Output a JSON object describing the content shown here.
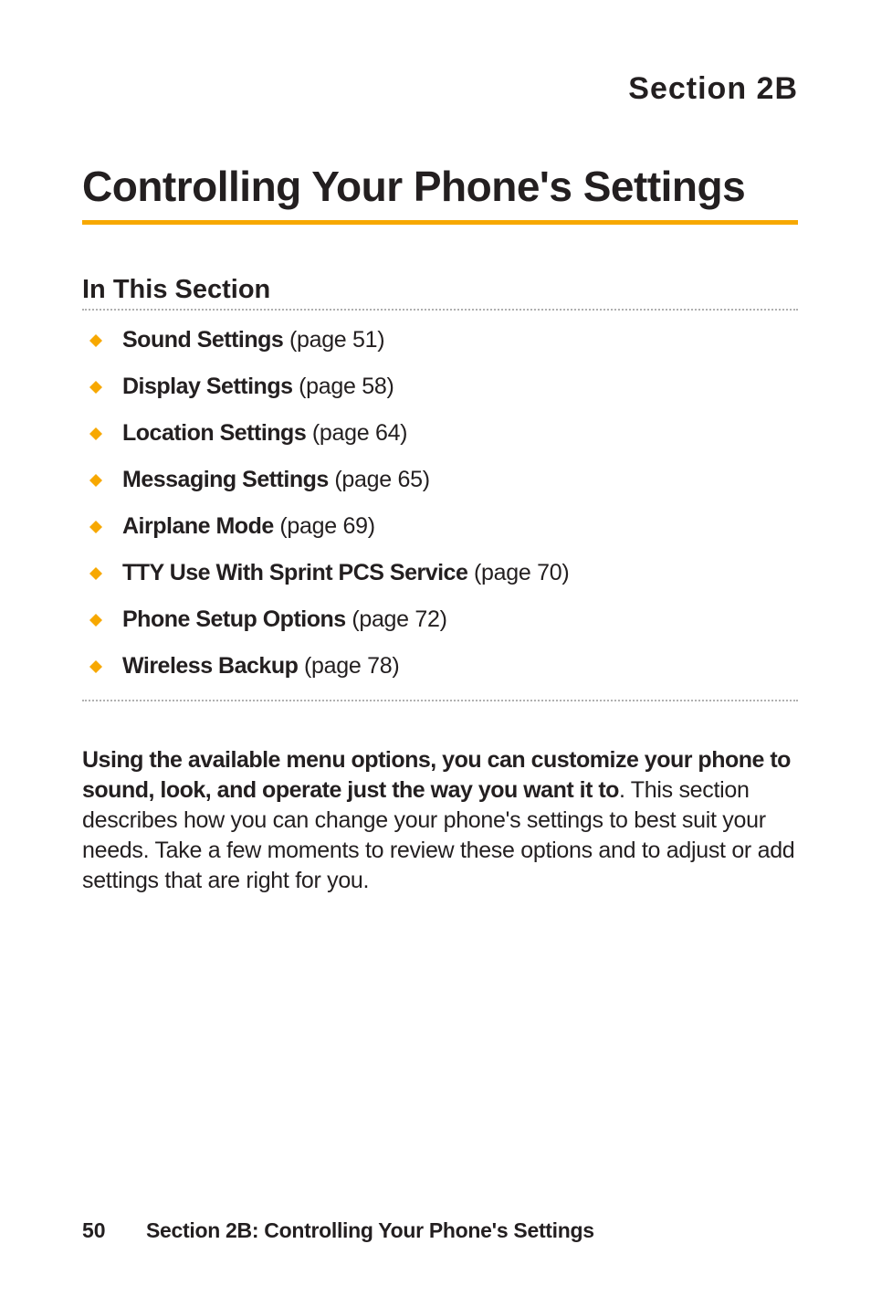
{
  "sectionLabel": "Section 2B",
  "title": "Controlling Your Phone's Settings",
  "subsectionHeading": "In This Section",
  "toc": [
    {
      "label": "Sound Settings",
      "page": " (page 51)"
    },
    {
      "label": "Display Settings",
      "page": " (page 58)"
    },
    {
      "label": "Location Settings",
      "page": " (page 64)"
    },
    {
      "label": "Messaging Settings",
      "page": " (page 65)"
    },
    {
      "label": "Airplane Mode",
      "page": " (page 69)"
    },
    {
      "label": "TTY Use With Sprint PCS Service",
      "page": " (page 70)"
    },
    {
      "label": "Phone Setup Options",
      "page": " (page 72)"
    },
    {
      "label": "Wireless Backup",
      "page": " (page 78)"
    }
  ],
  "body": {
    "bold": "Using the available menu options, you can customize your phone to sound, look, and operate just the way you want it to",
    "rest": ". This section describes how you can change your phone's settings to best suit your needs. Take a few moments to review these options and to adjust or add settings that are right for you."
  },
  "footer": {
    "pageNum": "50",
    "text": "Section 2B: Controlling Your Phone's Settings"
  }
}
